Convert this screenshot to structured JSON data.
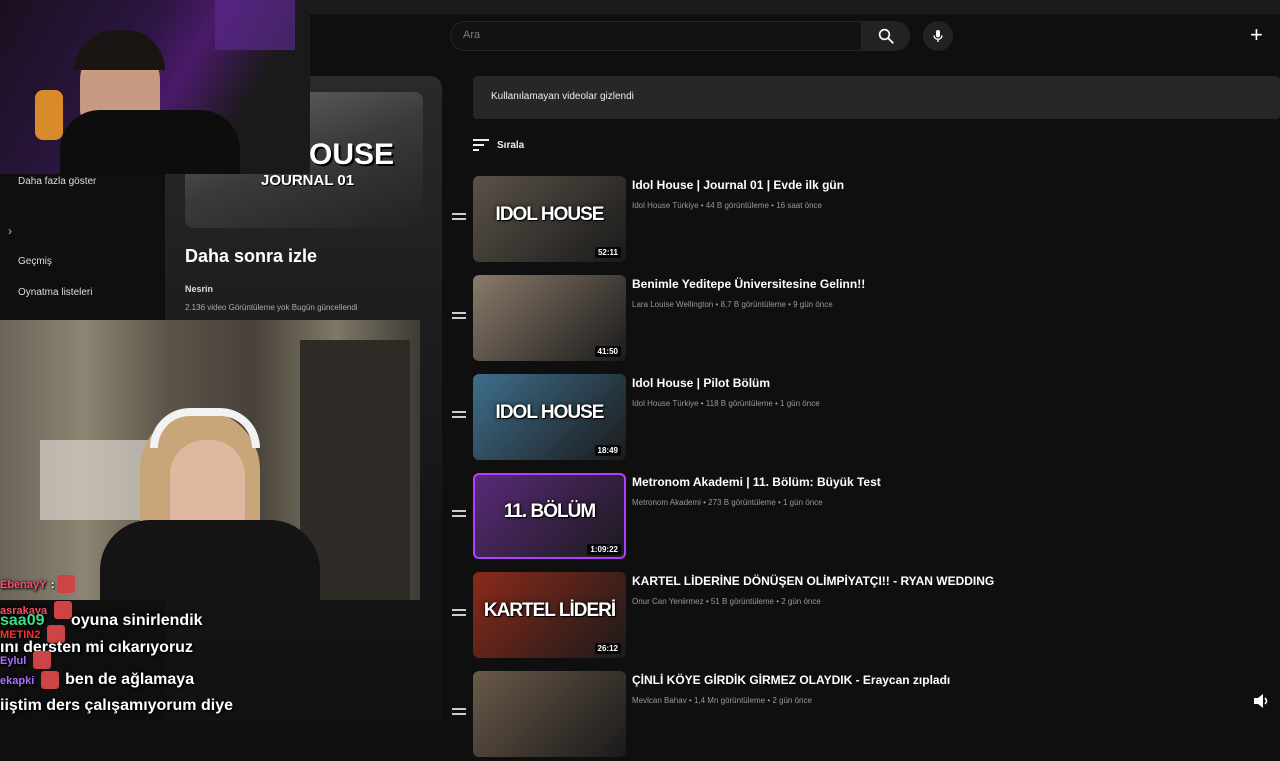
{
  "header": {
    "search_placeholder": "Ara",
    "icons": [
      "search-icon",
      "mic-icon",
      "plus-icon"
    ]
  },
  "sidebar": {
    "show_more": "Daha fazla göster",
    "history": "Geçmiş",
    "playlists": "Oynatma listeleri"
  },
  "playlist": {
    "thumb_text": "OUSE",
    "thumb_sub": "JOURNAL 01",
    "title": "Daha sonra izle",
    "owner": "Nesrin",
    "meta": "2.136 video  Görüntüleme yok  Bugün güncellendi"
  },
  "notice": "Kullanılamayan videolar gizlendi",
  "sort_label": "Sırala",
  "videos": [
    {
      "title": "Idol House | Journal 01 | Evde ilk gün",
      "meta": "Idol House Türkiye • 44 B görüntüleme • 16 saat önce",
      "duration": "52:11",
      "thumb_text": "IDOL HOUSE",
      "thumb_color": "#5a5248"
    },
    {
      "title": "Benimle Yeditepe Üniversitesine Gelinn!!",
      "meta": "Lara Louise Wellington • 8,7 B görüntüleme • 9 gün önce",
      "duration": "41:50",
      "thumb_text": "",
      "thumb_color": "#8a7a6a"
    },
    {
      "title": "Idol House | Pilot Bölüm",
      "meta": "Idol House Türkiye • 118 B görüntüleme • 1 gün önce",
      "duration": "18:49",
      "thumb_text": "IDOL HOUSE",
      "thumb_color": "#3f6e8c"
    },
    {
      "title": "Metronom Akademi | 11. Bölüm: Büyük Test",
      "meta": "Metronom Akademi • 273 B görüntüleme • 1 gün önce",
      "duration": "1:09:22",
      "thumb_text": "11. BÖLÜM",
      "thumb_color": "#5a2a7a"
    },
    {
      "title": "KARTEL LİDERİNE DÖNÜŞEN OLİMPİYATÇI!! - RYAN WEDDING",
      "meta": "Onur Can Yeniirmez • 51 B görüntüleme • 2 gün önce",
      "duration": "26:12",
      "thumb_text": "KARTEL LİDERİ",
      "thumb_color": "#8a2a1a"
    },
    {
      "title": "ÇİNLİ KÖYE GİRDİK GİRMEZ OLAYDIK - Eraycan zıpladı",
      "meta": "Mevlcan Bahav • 1,4 Mn görüntüleme • 2 gün önce",
      "duration": "",
      "thumb_text": "",
      "thumb_color": "#6a5a4a"
    }
  ],
  "chat": [
    {
      "user": "EbenayY",
      "user_color": "#ff4d6a",
      "text": ""
    },
    {
      "user": "asrakaya",
      "user_color": "#ff4d6a",
      "text": ""
    },
    {
      "user": "saa09",
      "user_color": "#3ddc84",
      "text": "oyuna sinirlendik"
    },
    {
      "user": "METIN2",
      "user_color": "#ff3030",
      "text": ""
    },
    {
      "user": "",
      "user_color": "#ffffff",
      "text": "ını dersten mi cıkarıyoruz"
    },
    {
      "user": "Eylul",
      "user_color": "#a970ff",
      "text": ""
    },
    {
      "user": "ekapki",
      "user_color": "#a970ff",
      "text": "ben de ağlamaya"
    },
    {
      "user": "",
      "user_color": "#ffffff",
      "text": "iiştim ders çalışamıyorum diye"
    }
  ]
}
